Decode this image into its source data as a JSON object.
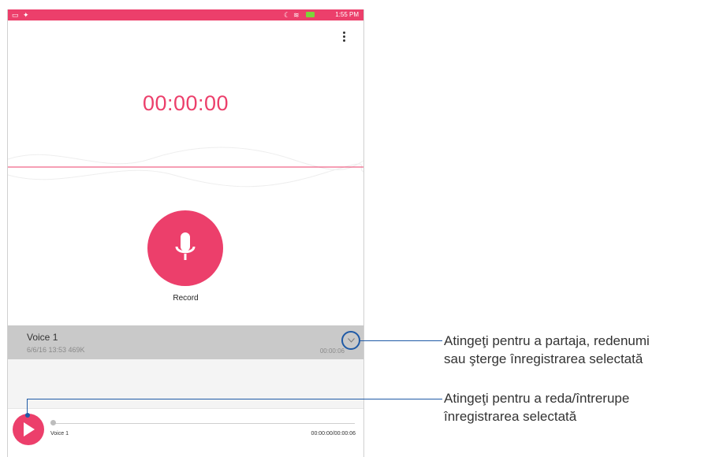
{
  "status_bar": {
    "time": "1:55 PM",
    "left_icons": [
      "image-icon",
      "notification-icon"
    ],
    "right_icons": [
      "moon-icon",
      "wifi-icon",
      "battery-icon"
    ]
  },
  "recorder": {
    "timer": "00:00:00",
    "record_label": "Record",
    "accent_color": "#ec3f6b"
  },
  "recording_item": {
    "name": "Voice 1",
    "meta": "6/6/16 13:53  469K",
    "duration": "00:00:06"
  },
  "player": {
    "track_name": "Voice 1",
    "time": "00:00:00/00:00:06",
    "progress_fraction": 0
  },
  "callouts": {
    "expand_line1": "Atingeţi pentru a partaja, redenumi",
    "expand_line2": "sau şterge înregistrarea selectată",
    "play_line1": "Atingeţi pentru a reda/întrerupe",
    "play_line2": "înregistrarea selectată"
  }
}
